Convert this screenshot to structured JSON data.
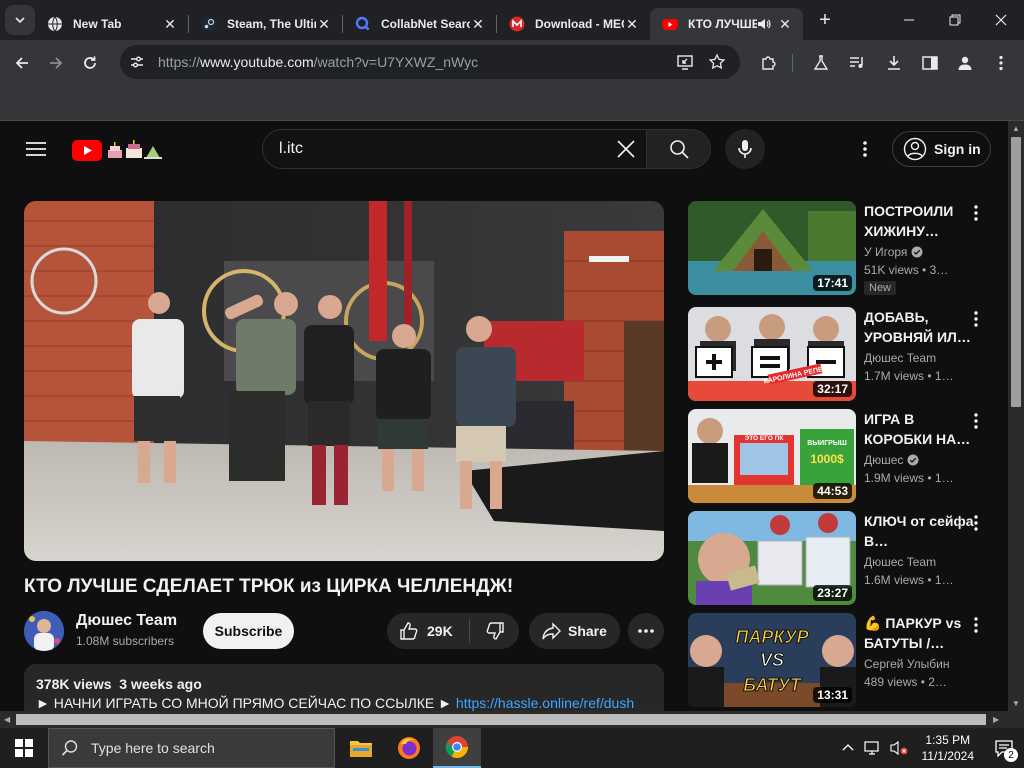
{
  "browser": {
    "tabs": [
      {
        "title": "New Tab",
        "favicon": "chrome-icon",
        "active": false
      },
      {
        "title": "Steam, The Ultimate",
        "favicon": "steam-icon",
        "active": false
      },
      {
        "title": "CollabNet Search",
        "favicon": "search-icon",
        "active": false
      },
      {
        "title": "Download - MEGA",
        "favicon": "mega-icon",
        "active": false
      },
      {
        "title": "КТО ЛУЧШЕ",
        "favicon": "youtube-icon",
        "active": true,
        "audio": true
      }
    ],
    "url_prefix": "https://",
    "url_host": "www.youtube.com",
    "url_path": "/watch?v=U7YXWZ_nWyc"
  },
  "youtube": {
    "search_value": "l.itc",
    "signin_label": "Sign in",
    "video": {
      "title": "КТО ЛУЧШЕ СДЕЛАЕТ ТРЮК из ЦИРКА ЧЕЛЛЕНДЖ!",
      "channel": "Дюшес Team",
      "subscribers": "1.08M subscribers",
      "subscribe_label": "Subscribe",
      "likes": "29K",
      "share_label": "Share",
      "views": "378K views",
      "age": "3 weeks ago",
      "desc_line": "► НАЧНИ ИГРАТЬ СО МНОЙ ПРЯМО СЕЙЧАС ПО ССЫЛКЕ ►",
      "desc_link": "https://hassle.online/ref/dush"
    },
    "suggestions": [
      {
        "title": "ПОСТРОИЛИ ХИЖИНУ…",
        "channel": "У Игоря",
        "verified": true,
        "views": "51K views",
        "age": "3…",
        "duration": "17:41",
        "badge": "New"
      },
      {
        "title": "ДОБАВЬ, УРОВНЯЙ ИЛ…",
        "channel": "Дюшес Team",
        "verified": false,
        "views": "1.7M views",
        "age": "1…",
        "duration": "32:17",
        "badge": ""
      },
      {
        "title": "ИГРА В КОРОБКИ НА…",
        "channel": "Дюшес",
        "verified": true,
        "views": "1.9M views",
        "age": "1…",
        "duration": "44:53",
        "badge": ""
      },
      {
        "title": "КЛЮЧ от сейфа В…",
        "channel": "Дюшес Team",
        "verified": false,
        "views": "1.6M views",
        "age": "1…",
        "duration": "23:27",
        "badge": ""
      },
      {
        "title": "💪 ПАРКУР vs БАТУТЫ /…",
        "channel": "Сергей Улыбин",
        "verified": false,
        "views": "489 views",
        "age": "2…",
        "duration": "13:31",
        "badge": ""
      }
    ]
  },
  "thumbnail_text": {
    "t2_banner": "КАРОЛИНА РЕПЕТ",
    "t3_screen": "ЭТО ЕГО ПК",
    "t3_box_top": "ВЫИГРЫШ",
    "t3_box_value": "1000$",
    "t5_top": "ПАРКУР",
    "t5_mid": "VS",
    "t5_bottom": "БАТУТ"
  },
  "taskbar": {
    "search_placeholder": "Type here to search",
    "time": "1:35 PM",
    "date": "11/1/2024",
    "notifications": "2"
  },
  "colors": {
    "yt_red": "#ff0000",
    "link": "#3ea6ff",
    "background": "#0f0f0f"
  }
}
